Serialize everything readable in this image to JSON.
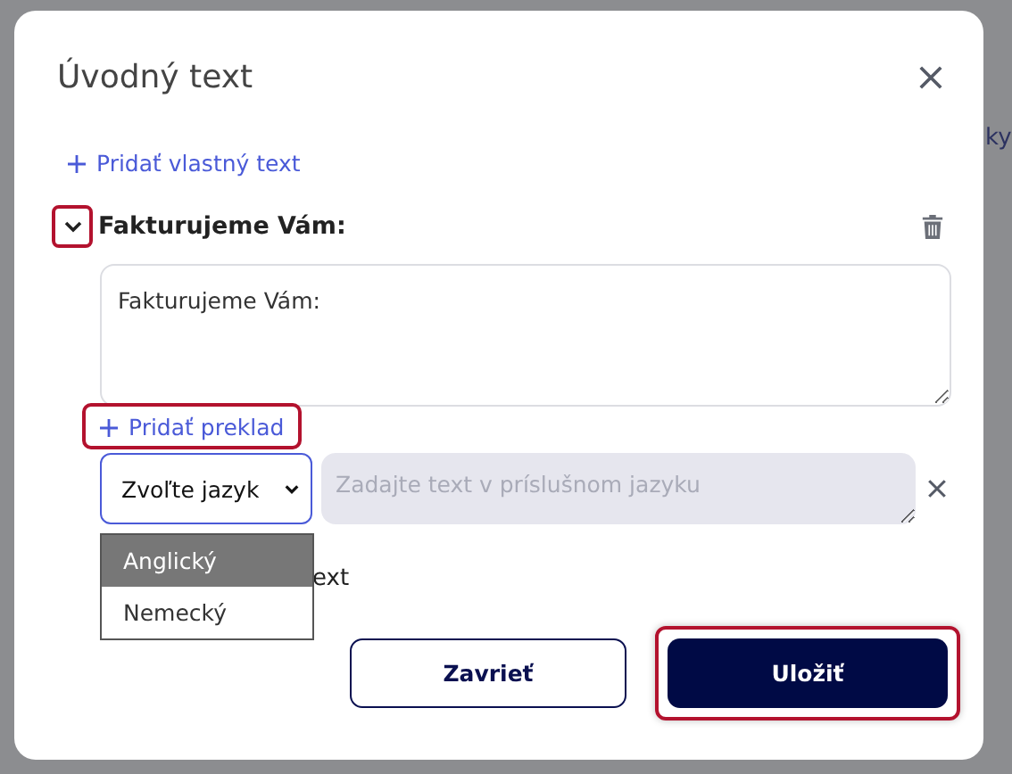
{
  "background_fragments": [
    "ky"
  ],
  "dialog": {
    "title": "Úvodný text"
  },
  "add_custom_text": {
    "label": "Pridať vlastný text"
  },
  "text_block": {
    "title": "Fakturujeme Vám:",
    "expanded": true,
    "expander_highlighted": true,
    "value": "Fakturujeme Vám:"
  },
  "add_translation": {
    "label": "Pridať preklad",
    "highlighted": true
  },
  "translation": {
    "language_select": "Zvoľte jazyk",
    "text_placeholder": "Zadajte text v príslušnom jazyku"
  },
  "language_options": [
    {
      "label": "Anglický",
      "selected": true
    },
    {
      "label": "Nemecký",
      "selected": false
    }
  ],
  "covered_link_text": "ext",
  "buttons": [
    {
      "label": "Zavrieť",
      "kind": "secondary",
      "highlighted": false
    },
    {
      "label": "Uložiť",
      "kind": "primary",
      "highlighted": true
    }
  ]
}
